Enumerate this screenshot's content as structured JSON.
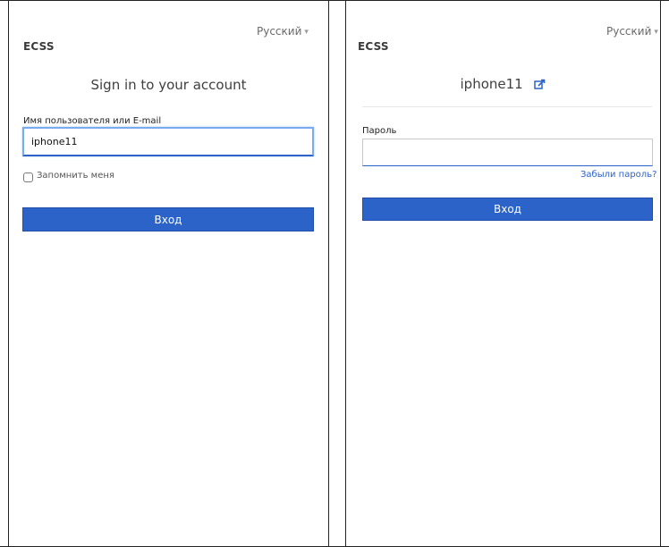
{
  "left": {
    "language": "Русский",
    "brand": "ECSS",
    "title": "Sign in to your account",
    "username_label": "Имя пользователя или E-mail",
    "username_value": "iphone11",
    "remember_label": "Запомнить меня",
    "login_button": "Вход"
  },
  "right": {
    "language": "Русский",
    "brand": "ECSS",
    "username": "iphone11",
    "password_label": "Пароль",
    "password_value": "",
    "forgot_link": "Забыли пароль?",
    "login_button": "Вход"
  },
  "icons": [
    "chevron-down-icon",
    "edit-icon"
  ],
  "colors": {
    "primary": "#2b63c9",
    "focus": "#7aaaf0",
    "text": "#222222"
  }
}
